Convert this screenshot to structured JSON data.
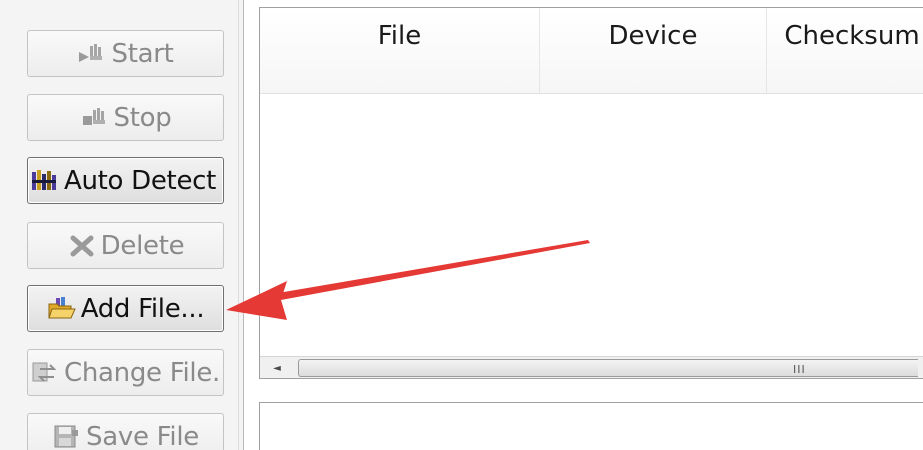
{
  "toolbar": {
    "start_label": "Start",
    "stop_label": "Stop",
    "auto_detect_label": "Auto Detect",
    "delete_label": "Delete",
    "add_file_label": "Add File...",
    "change_file_label": "Change File.",
    "save_file_label": "Save File"
  },
  "table": {
    "columns": [
      "File",
      "Device",
      "Checksum"
    ],
    "rows": []
  },
  "scrollbar": {
    "grip": "III"
  },
  "annotation": {
    "arrow_color": "#e53935"
  }
}
